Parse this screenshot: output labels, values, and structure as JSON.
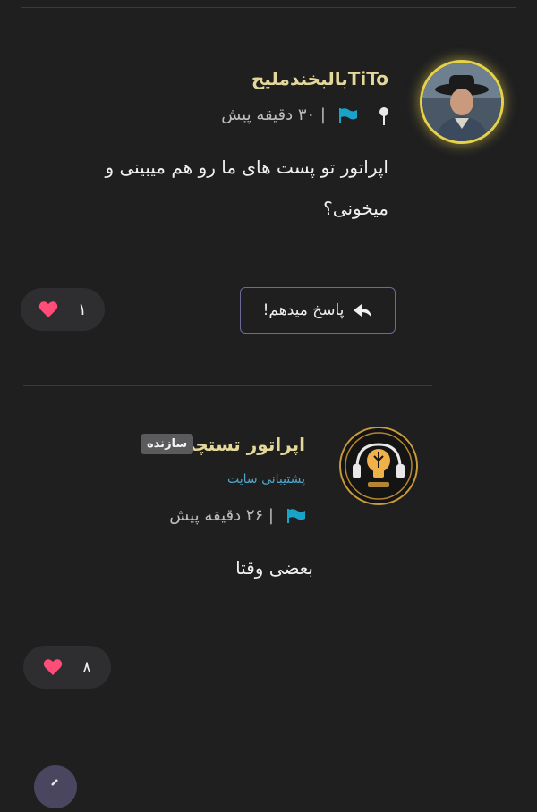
{
  "comments": [
    {
      "username": "TiToبالبخندملیح",
      "time": "| ۳۰ دقیقه پیش",
      "text_line1": "اپراتور تو پست های ما رو هم میبینی و",
      "text_line2": "میخونی؟",
      "reply_label": "پاسخ میدهم!",
      "likes": "۱"
    },
    {
      "username": "اپراتور تستچی",
      "badge": "سازنده",
      "role": "پشتیبانی سایت",
      "time": "| ۲۶ دقیقه پیش",
      "text": "بعضی وقتا",
      "likes": "۸"
    }
  ],
  "colors": {
    "background": "#1f1f20",
    "username": "#e3d79a",
    "flag": "#1aa3c8",
    "heart": "#ff4d78",
    "role": "#4fa5c9",
    "avatar_glow": "#e6d24a"
  },
  "icons": [
    "pin-icon",
    "flag-icon",
    "reply-arrow-icon",
    "heart-icon"
  ]
}
